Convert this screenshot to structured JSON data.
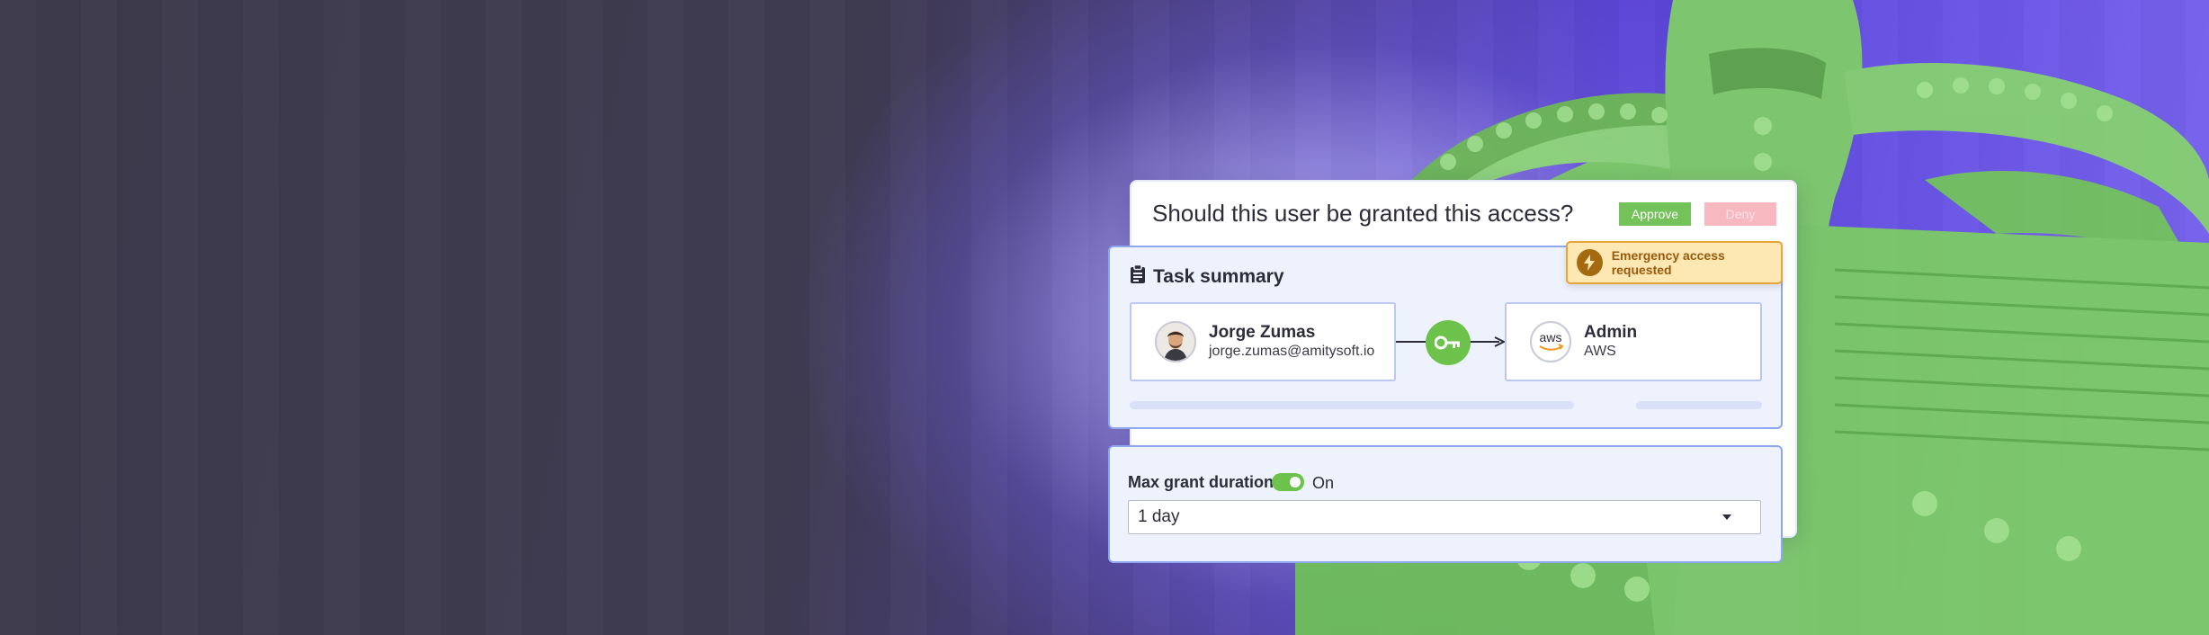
{
  "request": {
    "question": "Should this user be granted this access?",
    "approve_label": "Approve",
    "deny_label": "Deny"
  },
  "task": {
    "title": "Task summary",
    "emergency_label": "Emergency access requested",
    "user": {
      "name": "Jorge Zumas",
      "email": "jorge.zumas@amitysoft.io"
    },
    "target": {
      "role": "Admin",
      "provider": "AWS",
      "logo_text": "aws"
    }
  },
  "duration": {
    "label": "Max grant duration",
    "toggle_state": "On",
    "selected": "1 day"
  },
  "colors": {
    "approve": "#74c35a",
    "deny": "#f7b8bf",
    "accent_border": "#8ea8f0",
    "key_green": "#6cc24a",
    "emergency_bg": "#fde7b3"
  },
  "icons": {
    "task": "clipboard-icon",
    "emergency": "lightning-icon",
    "grant": "key-icon",
    "dropdown": "caret-down-icon"
  }
}
